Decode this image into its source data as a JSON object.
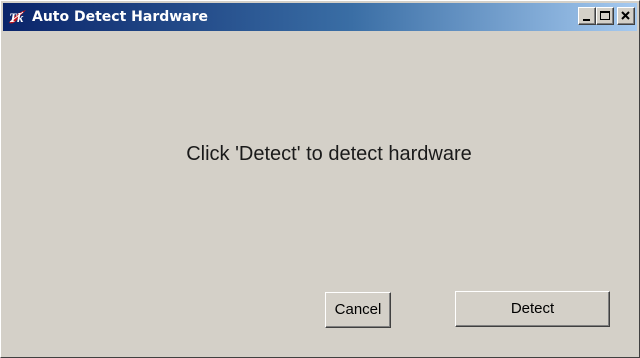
{
  "window": {
    "title": "Auto Detect Hardware",
    "icon": "tk-feather-icon",
    "caption_buttons": [
      "minimize-icon",
      "maximize-icon",
      "close-icon"
    ]
  },
  "content": {
    "message": "Click 'Detect' to detect hardware"
  },
  "buttons": {
    "cancel_label": "Cancel",
    "detect_label": "Detect"
  },
  "colors": {
    "titlebar_start": "#0a246a",
    "titlebar_end": "#a6caf0",
    "face": "#d4d0c8"
  }
}
